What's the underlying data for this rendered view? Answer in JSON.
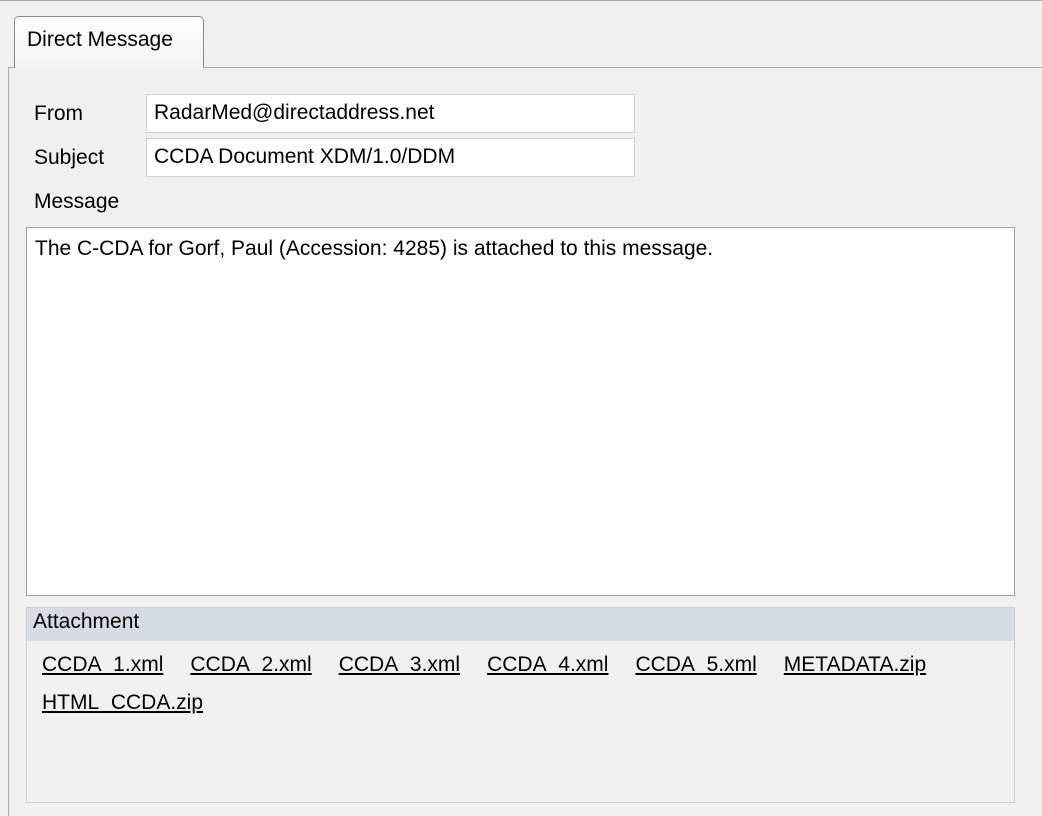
{
  "tab": {
    "label": "Direct Message"
  },
  "form": {
    "from_label": "From",
    "from_value": "RadarMed@directaddress.net",
    "subject_label": "Subject",
    "subject_value": "CCDA Document XDM/1.0/DDM",
    "message_label": "Message",
    "message_value": "The C-CDA for Gorf, Paul (Accession: 4285) is attached to this message."
  },
  "attachments": {
    "header": "Attachment",
    "files": [
      "CCDA_1.xml",
      "CCDA_2.xml",
      "CCDA_3.xml",
      "CCDA_4.xml",
      "CCDA_5.xml",
      "METADATA.zip",
      "HTML_CCDA.zip"
    ]
  }
}
